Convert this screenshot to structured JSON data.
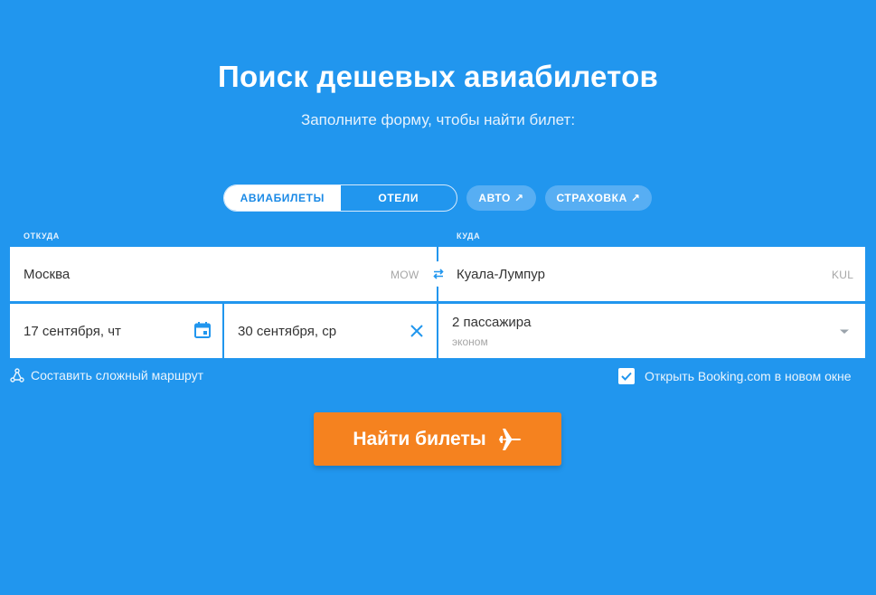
{
  "header": {
    "title": "Поиск дешевых авиабилетов",
    "subtitle": "Заполните форму, чтобы найти билет:"
  },
  "tabs": [
    {
      "label": "АВИАБИЛЕТЫ",
      "active": true
    },
    {
      "label": "ОТЕЛИ",
      "active": false
    }
  ],
  "external_links": [
    {
      "label": "АВТО",
      "icon": "external-arrow-icon"
    },
    {
      "label": "СТРАХОВКА",
      "icon": "external-arrow-icon"
    }
  ],
  "form": {
    "from_label": "ОТКУДА",
    "to_label": "КУДА",
    "from_city": "Москва",
    "from_iata": "MOW",
    "to_city": "Куала-Лумпур",
    "to_iata": "KUL",
    "depart_date": "17 сентября, чт",
    "return_date": "30 сентября, ср",
    "passengers": "2 пассажира",
    "cabin_class": "эконом"
  },
  "options": {
    "complex_route": "Составить сложный маршрут",
    "booking_checkbox": "Открыть Booking.com в новом окне",
    "booking_checked": true
  },
  "search_button": "Найти билеты",
  "colors": {
    "background": "#2196ee",
    "accent": "#f5821f",
    "tab_active_text": "#1b8ae6"
  }
}
